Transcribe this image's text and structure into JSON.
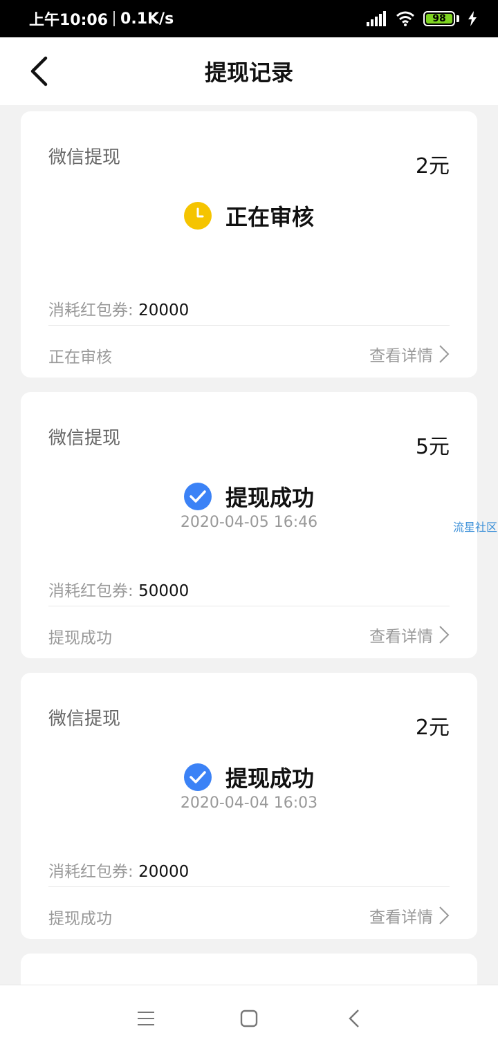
{
  "status_bar": {
    "time": "上午10:06",
    "speed": "0.1K/s",
    "battery": "98"
  },
  "header": {
    "title": "提现记录"
  },
  "records": [
    {
      "type": "微信提现",
      "amount": "2元",
      "status": "正在审核",
      "status_icon": "clock-icon",
      "time": "",
      "consume_label": "消耗红包券: ",
      "consume_value": "20000",
      "footer_status": "正在审核",
      "detail_label": "查看详情"
    },
    {
      "type": "微信提现",
      "amount": "5元",
      "status": "提现成功",
      "status_icon": "check-circle-icon",
      "time": "2020-04-05 16:46",
      "consume_label": "消耗红包券: ",
      "consume_value": "50000",
      "footer_status": "提现成功",
      "detail_label": "查看详情"
    },
    {
      "type": "微信提现",
      "amount": "2元",
      "status": "提现成功",
      "status_icon": "check-circle-icon",
      "time": "2020-04-04 16:03",
      "consume_label": "消耗红包券: ",
      "consume_value": "20000",
      "footer_status": "提现成功",
      "detail_label": "查看详情"
    }
  ],
  "watermark": "流星社区",
  "colors": {
    "pending": "#F5C400",
    "success": "#3B82F6"
  }
}
